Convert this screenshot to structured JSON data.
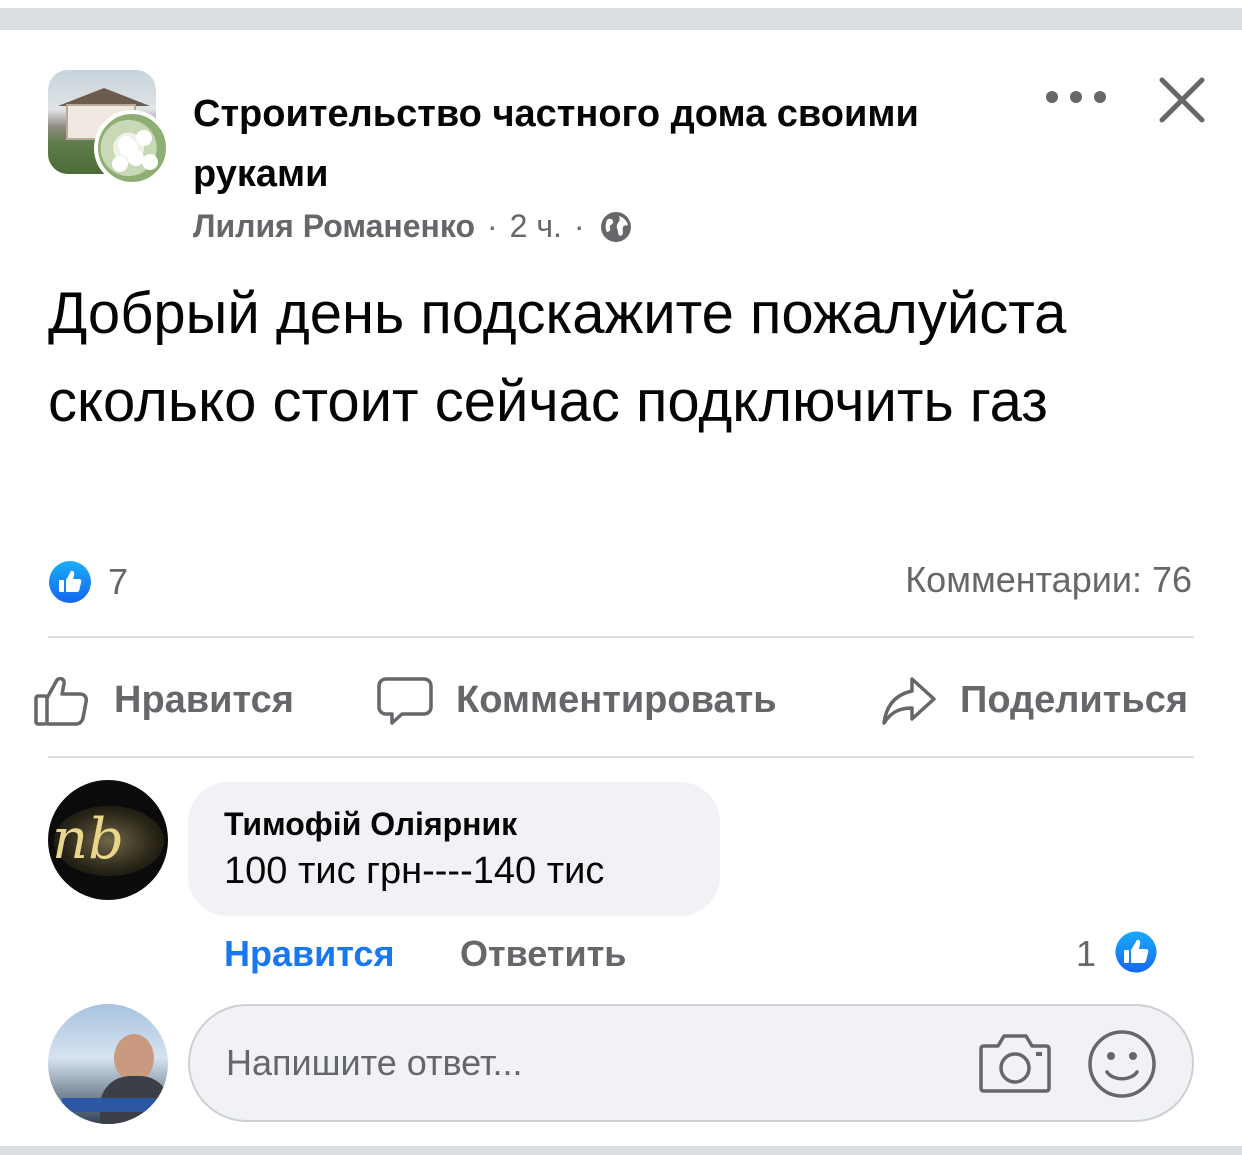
{
  "post": {
    "group_name": "Строительство частного дома своими руками",
    "author": "Лилия Романенко",
    "separator": "·",
    "time": "2 ч.",
    "visibility_icon": "globe-icon",
    "text": "Добрый день подскажите пожалуйста сколько стоит сейчас подключить газ",
    "like_count": "7",
    "comments_label": "Комментарии: 76"
  },
  "actions": {
    "like_label": "Нравится",
    "comment_label": "Комментировать",
    "share_label": "Поделиться"
  },
  "comment": {
    "author": "Тимофій Оліярник",
    "text": "100 тис грн----140 тис",
    "like_label": "Нравится",
    "reply_label": "Ответить",
    "reaction_count": "1"
  },
  "reply_box": {
    "placeholder": "Напишите ответ..."
  },
  "colors": {
    "facebook_blue": "#1877f2",
    "secondary_text": "#65676b",
    "divider": "#dadde1",
    "bubble_bg": "#f0f2f5"
  }
}
